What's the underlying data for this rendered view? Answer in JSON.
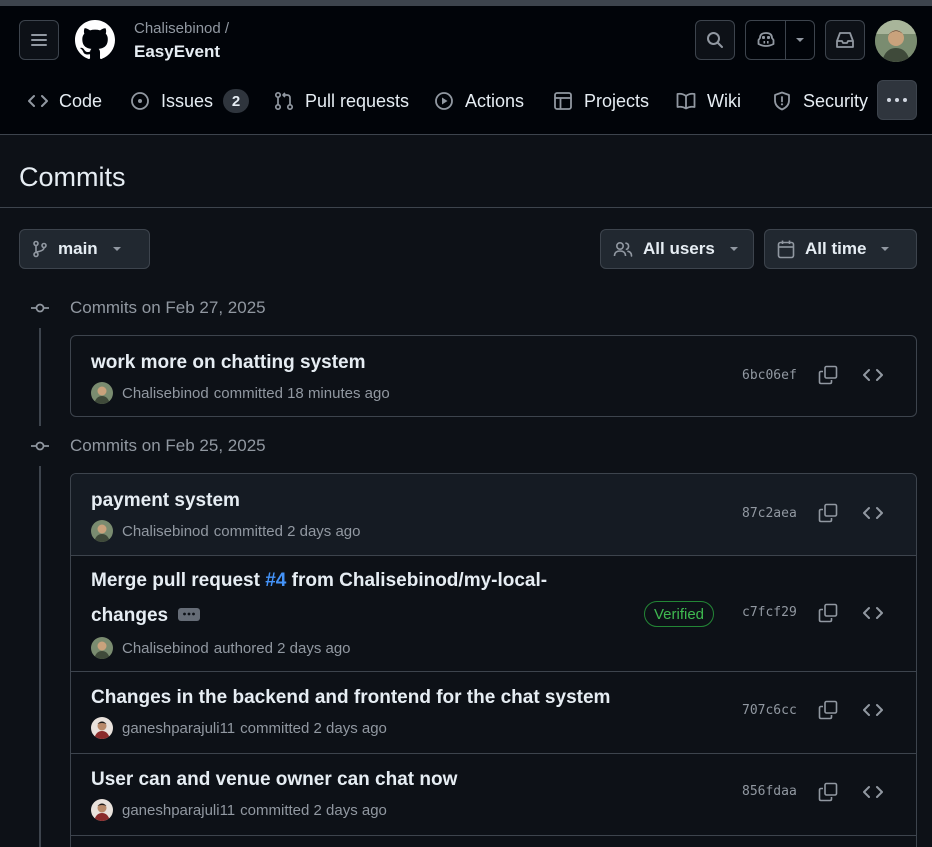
{
  "repo": {
    "owner": "Chalisebinod /",
    "name": "EasyEvent"
  },
  "nav": [
    {
      "label": "Code",
      "icon": "code-icon"
    },
    {
      "label": "Issues",
      "icon": "issue-icon",
      "count": "2"
    },
    {
      "label": "Pull requests",
      "icon": "pull-request-icon"
    },
    {
      "label": "Actions",
      "icon": "play-icon"
    },
    {
      "label": "Projects",
      "icon": "table-icon"
    },
    {
      "label": "Wiki",
      "icon": "book-icon"
    },
    {
      "label": "Security",
      "icon": "shield-icon"
    }
  ],
  "page": {
    "title": "Commits"
  },
  "filters": {
    "branch": "main",
    "users": "All users",
    "time": "All time"
  },
  "groups": [
    {
      "heading": "Commits on Feb 27, 2025",
      "commits": [
        {
          "message": "work more on chatting system",
          "author": "Chalisebinod",
          "action": "committed 18 minutes ago",
          "sha": "6bc06ef"
        }
      ]
    },
    {
      "heading": "Commits on Feb 25, 2025",
      "commits": [
        {
          "message": "payment system",
          "author": "Chalisebinod",
          "action": "committed 2 days ago",
          "sha": "87c2aea"
        },
        {
          "message_pre": "Merge pull request ",
          "message_link": "#4",
          "message_line1_post": " from Chalisebinod/my-local-",
          "message_line2": "changes",
          "author": "Chalisebinod",
          "action": "authored 2 days ago",
          "sha": "c7fcf29",
          "badge": "Verified"
        },
        {
          "message": "Changes in the backend and frontend for the chat system",
          "author": "ganeshparajuli11",
          "action": "committed 2 days ago",
          "sha": "707c6cc"
        },
        {
          "message": "User can and venue owner can chat now",
          "author": "ganeshparajuli11",
          "action": "committed 2 days ago",
          "sha": "856fdaa"
        }
      ]
    }
  ],
  "colors": {
    "bg": "#0d1117",
    "header": "#010409",
    "border": "#3d444d",
    "link": "#4493f8",
    "verified": "#3fb950"
  }
}
